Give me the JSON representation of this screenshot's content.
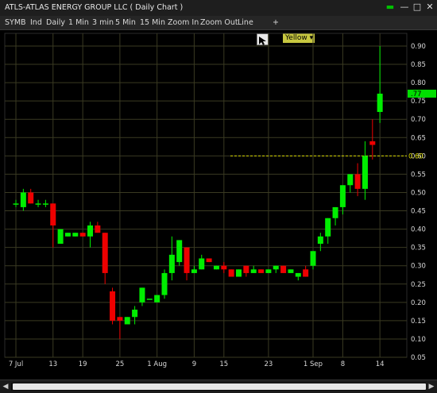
{
  "window": {
    "title": "ATLS-ATLAS ENERGY GROUP LLC ( Daily Chart )",
    "buttons": [
      "▬",
      "—",
      "□",
      "✕"
    ]
  },
  "toolbar": {
    "items": [
      "SYMB",
      "Ind",
      "Daily",
      "1 Min",
      "3 min",
      "5 Min",
      "15 Min",
      "Zoom In",
      "Zoom Out",
      "Line"
    ],
    "plus": "+",
    "color_value": "Yellow",
    "color_arrow": "▾"
  },
  "colors": {
    "up": "#00ee00",
    "down": "#ee0000",
    "grid": "#3a3a22",
    "level_line": "#d8d800",
    "last_price_tag": "#00dd00"
  },
  "chart_data": {
    "type": "candlestick",
    "ylim": [
      0.05,
      0.9
    ],
    "y_ticks": [
      0.9,
      0.85,
      0.8,
      0.75,
      0.7,
      0.65,
      0.6,
      0.55,
      0.5,
      0.45,
      0.4,
      0.35,
      0.3,
      0.25,
      0.2,
      0.15,
      0.1,
      0.05
    ],
    "x_tick_labels": [
      "7 Jul",
      "13",
      "19",
      "25",
      "1 Aug",
      "9",
      "15",
      "23",
      "1 Sep",
      "8",
      "14"
    ],
    "horizontal_line": {
      "value": 0.6,
      "label": "0.60"
    },
    "last_price_label": ".77",
    "candles": [
      {
        "date": "Jul 7",
        "open": 0.47,
        "high": 0.48,
        "low": 0.46,
        "close": 0.47
      },
      {
        "date": "Jul 8",
        "open": 0.46,
        "high": 0.51,
        "low": 0.45,
        "close": 0.5
      },
      {
        "date": "Jul 9",
        "open": 0.5,
        "high": 0.51,
        "low": 0.47,
        "close": 0.47
      },
      {
        "date": "Jul 10",
        "open": 0.47,
        "high": 0.48,
        "low": 0.46,
        "close": 0.47
      },
      {
        "date": "Jul 11",
        "open": 0.47,
        "high": 0.48,
        "low": 0.46,
        "close": 0.47
      },
      {
        "date": "Jul 14",
        "open": 0.47,
        "high": 0.47,
        "low": 0.35,
        "close": 0.41
      },
      {
        "date": "Jul 15",
        "open": 0.36,
        "high": 0.4,
        "low": 0.36,
        "close": 0.4
      },
      {
        "date": "Jul 16",
        "open": 0.38,
        "high": 0.39,
        "low": 0.38,
        "close": 0.39
      },
      {
        "date": "Jul 17",
        "open": 0.38,
        "high": 0.39,
        "low": 0.38,
        "close": 0.39
      },
      {
        "date": "Jul 18",
        "open": 0.39,
        "high": 0.39,
        "low": 0.38,
        "close": 0.38
      },
      {
        "date": "Jul 21",
        "open": 0.38,
        "high": 0.42,
        "low": 0.35,
        "close": 0.41
      },
      {
        "date": "Jul 22",
        "open": 0.41,
        "high": 0.42,
        "low": 0.39,
        "close": 0.39
      },
      {
        "date": "Jul 23",
        "open": 0.39,
        "high": 0.39,
        "low": 0.25,
        "close": 0.28
      },
      {
        "date": "Jul 24",
        "open": 0.23,
        "high": 0.24,
        "low": 0.14,
        "close": 0.15
      },
      {
        "date": "Jul 25",
        "open": 0.16,
        "high": 0.16,
        "low": 0.1,
        "close": 0.15
      },
      {
        "date": "Jul 28",
        "open": 0.14,
        "high": 0.16,
        "low": 0.14,
        "close": 0.16
      },
      {
        "date": "Jul 29",
        "open": 0.16,
        "high": 0.19,
        "low": 0.14,
        "close": 0.18
      },
      {
        "date": "Jul 30",
        "open": 0.2,
        "high": 0.24,
        "low": 0.19,
        "close": 0.24
      },
      {
        "date": "Jul 31",
        "open": 0.21,
        "high": 0.21,
        "low": 0.21,
        "close": 0.21
      },
      {
        "date": "Aug 1",
        "open": 0.2,
        "high": 0.22,
        "low": 0.2,
        "close": 0.22
      },
      {
        "date": "Aug 4",
        "open": 0.22,
        "high": 0.29,
        "low": 0.21,
        "close": 0.28
      },
      {
        "date": "Aug 5",
        "open": 0.28,
        "high": 0.38,
        "low": 0.26,
        "close": 0.33
      },
      {
        "date": "Aug 6",
        "open": 0.31,
        "high": 0.37,
        "low": 0.3,
        "close": 0.37
      },
      {
        "date": "Aug 7",
        "open": 0.35,
        "high": 0.35,
        "low": 0.26,
        "close": 0.28
      },
      {
        "date": "Aug 8",
        "open": 0.28,
        "high": 0.3,
        "low": 0.28,
        "close": 0.29
      },
      {
        "date": "Aug 11",
        "open": 0.29,
        "high": 0.33,
        "low": 0.29,
        "close": 0.32
      },
      {
        "date": "Aug 12",
        "open": 0.32,
        "high": 0.32,
        "low": 0.31,
        "close": 0.31
      },
      {
        "date": "Aug 13",
        "open": 0.29,
        "high": 0.3,
        "low": 0.29,
        "close": 0.3
      },
      {
        "date": "Aug 14",
        "open": 0.3,
        "high": 0.31,
        "low": 0.28,
        "close": 0.29
      },
      {
        "date": "Aug 15",
        "open": 0.29,
        "high": 0.29,
        "low": 0.27,
        "close": 0.27
      },
      {
        "date": "Aug 18",
        "open": 0.27,
        "high": 0.29,
        "low": 0.27,
        "close": 0.29
      },
      {
        "date": "Aug 19",
        "open": 0.3,
        "high": 0.3,
        "low": 0.27,
        "close": 0.28
      },
      {
        "date": "Aug 20",
        "open": 0.28,
        "high": 0.3,
        "low": 0.28,
        "close": 0.29
      },
      {
        "date": "Aug 21",
        "open": 0.29,
        "high": 0.29,
        "low": 0.28,
        "close": 0.28
      },
      {
        "date": "Aug 22",
        "open": 0.28,
        "high": 0.29,
        "low": 0.28,
        "close": 0.29
      },
      {
        "date": "Aug 25",
        "open": 0.29,
        "high": 0.3,
        "low": 0.28,
        "close": 0.3
      },
      {
        "date": "Aug 26",
        "open": 0.3,
        "high": 0.3,
        "low": 0.28,
        "close": 0.28
      },
      {
        "date": "Aug 27",
        "open": 0.28,
        "high": 0.29,
        "low": 0.28,
        "close": 0.29
      },
      {
        "date": "Aug 28",
        "open": 0.27,
        "high": 0.28,
        "low": 0.26,
        "close": 0.28
      },
      {
        "date": "Aug 29",
        "open": 0.29,
        "high": 0.3,
        "low": 0.27,
        "close": 0.27
      },
      {
        "date": "Sep 2",
        "open": 0.3,
        "high": 0.34,
        "low": 0.29,
        "close": 0.34
      },
      {
        "date": "Sep 3",
        "open": 0.36,
        "high": 0.39,
        "low": 0.34,
        "close": 0.38
      },
      {
        "date": "Sep 4",
        "open": 0.38,
        "high": 0.43,
        "low": 0.36,
        "close": 0.43
      },
      {
        "date": "Sep 5",
        "open": 0.43,
        "high": 0.46,
        "low": 0.41,
        "close": 0.46
      },
      {
        "date": "Sep 8",
        "open": 0.46,
        "high": 0.52,
        "low": 0.44,
        "close": 0.52
      },
      {
        "date": "Sep 9",
        "open": 0.52,
        "high": 0.55,
        "low": 0.5,
        "close": 0.55
      },
      {
        "date": "Sep 10",
        "open": 0.55,
        "high": 0.58,
        "low": 0.49,
        "close": 0.51
      },
      {
        "date": "Sep 11",
        "open": 0.51,
        "high": 0.64,
        "low": 0.48,
        "close": 0.6
      },
      {
        "date": "Sep 12",
        "open": 0.64,
        "high": 0.7,
        "low": 0.59,
        "close": 0.63
      },
      {
        "date": "Sep 15",
        "open": 0.72,
        "high": 0.9,
        "low": 0.69,
        "close": 0.77
      }
    ]
  }
}
